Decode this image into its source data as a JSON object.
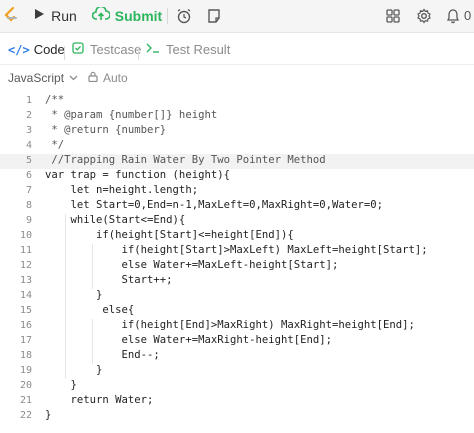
{
  "toolbar": {
    "run_label": "Run",
    "submit_label": "Submit",
    "streak_count": "0",
    "icons": [
      "leetcode-logo-icon",
      "play-icon",
      "cloud-upload-icon",
      "alarm-clock-icon",
      "note-icon",
      "layout-icon",
      "gear-icon",
      "bell-icon"
    ]
  },
  "tabs": {
    "code": "Code",
    "testcase": "Testcase",
    "test_result": "Test Result"
  },
  "editor_settings": {
    "language": "JavaScript",
    "auto": "Auto"
  },
  "editor": {
    "lines": [
      {
        "n": "1",
        "text": "/**"
      },
      {
        "n": "2",
        "text": " * @param {number[]} height"
      },
      {
        "n": "3",
        "text": " * @return {number}"
      },
      {
        "n": "4",
        "text": " */"
      },
      {
        "n": "5",
        "text": " //Trapping Rain Water By Two Pointer Method"
      },
      {
        "n": "6",
        "text": "var trap = function (height){"
      },
      {
        "n": "7",
        "text": "    let n=height.length;"
      },
      {
        "n": "8",
        "text": "    let Start=0,End=n-1,MaxLeft=0,MaxRight=0,Water=0;"
      },
      {
        "n": "9",
        "text": "    while(Start<=End){"
      },
      {
        "n": "10",
        "text": "        if(height[Start]<=height[End]){"
      },
      {
        "n": "11",
        "text": "            if(height[Start]>MaxLeft) MaxLeft=height[Start];"
      },
      {
        "n": "12",
        "text": "            else Water+=MaxLeft-height[Start];"
      },
      {
        "n": "13",
        "text": "            Start++;"
      },
      {
        "n": "14",
        "text": "        }"
      },
      {
        "n": "15",
        "text": "         else{"
      },
      {
        "n": "16",
        "text": "            if(height[End]>MaxRight) MaxRight=height[End];"
      },
      {
        "n": "17",
        "text": "            else Water+=MaxRight-height[End];"
      },
      {
        "n": "18",
        "text": "            End--;"
      },
      {
        "n": "19",
        "text": "        }"
      },
      {
        "n": "20",
        "text": "    }"
      },
      {
        "n": "21",
        "text": "    return Water;"
      },
      {
        "n": "22",
        "text": "}"
      }
    ],
    "highlighted_line": 5
  },
  "colors": {
    "accent_blue": "#2d7de8",
    "submit_green": "#2db55d",
    "comment_gray": "#555555"
  }
}
